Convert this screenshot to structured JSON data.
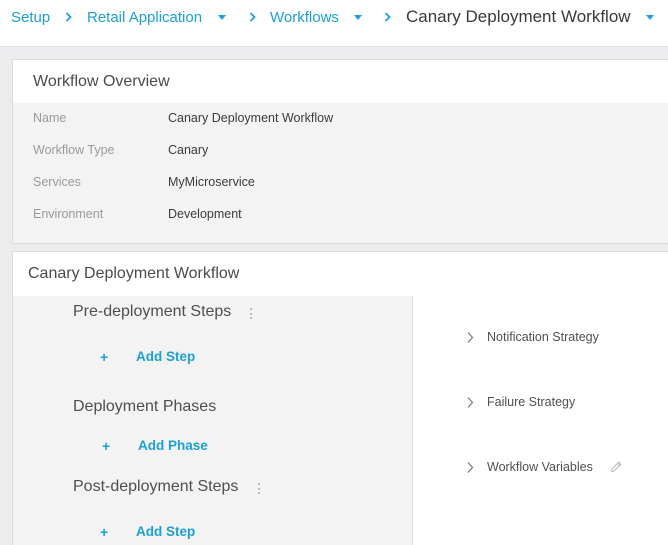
{
  "breadcrumb": {
    "items": [
      "Setup",
      "Retail Application",
      "Workflows"
    ],
    "current": "Canary Deployment Workflow"
  },
  "overview": {
    "title": "Workflow Overview",
    "fields": [
      {
        "label": "Name",
        "value": "Canary Deployment Workflow"
      },
      {
        "label": "Workflow Type",
        "value": "Canary"
      },
      {
        "label": "Services",
        "value": "MyMicroservice"
      },
      {
        "label": "Environment",
        "value": "Development"
      }
    ]
  },
  "workflow": {
    "title": "Canary Deployment Workflow",
    "sections": [
      {
        "title": "Pre-deployment Steps",
        "add_label": "Add Step",
        "plus": "+"
      },
      {
        "title": "Deployment Phases",
        "add_label": "Add Phase",
        "plus": "+"
      },
      {
        "title": "Post-deployment Steps",
        "add_label": "Add Step",
        "plus": "+"
      }
    ],
    "right_items": [
      {
        "label": "Notification Strategy"
      },
      {
        "label": "Failure Strategy"
      },
      {
        "label": "Workflow Variables"
      }
    ]
  },
  "colors": {
    "accent": "#1ba0d8",
    "text": "#4a4a4a",
    "muted": "#9a9a9a",
    "panel": "#f3f3f4"
  },
  "icons": [
    "chevron-right-icon",
    "caret-down-icon",
    "kebab-icon",
    "plus-icon",
    "pencil-icon"
  ]
}
